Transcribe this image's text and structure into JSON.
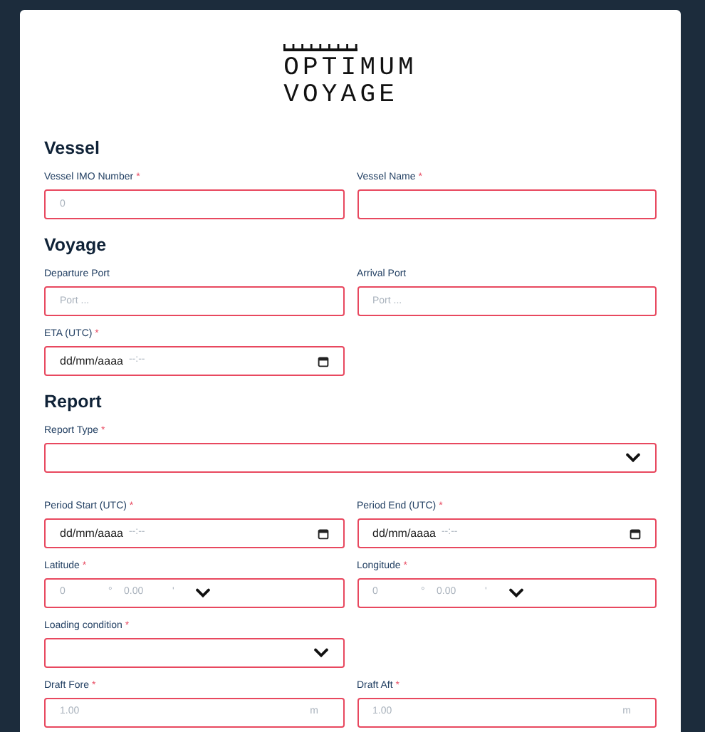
{
  "logo": {
    "lines": [
      "OPTIMUM",
      "VOYAGE"
    ]
  },
  "sections": [
    {
      "title": "Vessel",
      "rows": [
        {
          "fields": [
            {
              "kind": "text",
              "label": "Vessel IMO Number",
              "mark": "*",
              "placeholder": "0"
            },
            {
              "kind": "text",
              "label": "Vessel Name",
              "mark": "*"
            }
          ]
        }
      ]
    },
    {
      "title": "Voyage",
      "rows": [
        {
          "fields": [
            {
              "kind": "text",
              "label": "Departure Port",
              "placeholder": "Port ..."
            },
            {
              "kind": "text",
              "label": "Arrival Port",
              "placeholder": "Port ..."
            }
          ]
        },
        {
          "fields": [
            {
              "kind": "date",
              "label": "ETA (UTC)",
              "mark": "*",
              "date": "dd/mm/aaaa",
              "time": "--:--"
            }
          ]
        }
      ]
    },
    {
      "title": "Report",
      "rows": [
        {
          "wide": true,
          "fields": [
            {
              "kind": "select",
              "label": "Report Type",
              "mark": "*"
            }
          ]
        },
        {
          "fields": [
            {
              "kind": "date",
              "label": "Period Start (UTC)",
              "mark": "*",
              "date": "dd/mm/aaaa",
              "time": "--:--"
            },
            {
              "kind": "date",
              "label": "Period End (UTC)",
              "mark": "*",
              "date": "dd/mm/aaaa",
              "time": "--:--"
            }
          ]
        },
        {
          "fields": [
            {
              "kind": "coord",
              "label": "Latitude",
              "mark": "*",
              "degrees": "0",
              "degree_sign": "°",
              "minutes": "0.00",
              "minute_sign": "'"
            },
            {
              "kind": "coord",
              "label": "Longitude",
              "mark": "*",
              "degrees": "0",
              "degree_sign": "°",
              "minutes": "0.00",
              "minute_sign": "'"
            }
          ]
        },
        {
          "fields": [
            {
              "kind": "select",
              "label": "Loading condition",
              "mark": "*"
            }
          ]
        },
        {
          "fields": [
            {
              "kind": "unit",
              "label": "Draft Fore",
              "mark": "*",
              "placeholder": "1.00",
              "unit": "m"
            },
            {
              "kind": "unit",
              "label": "Draft Aft",
              "mark": "*",
              "placeholder": "1.00",
              "unit": "m"
            }
          ]
        }
      ]
    }
  ]
}
